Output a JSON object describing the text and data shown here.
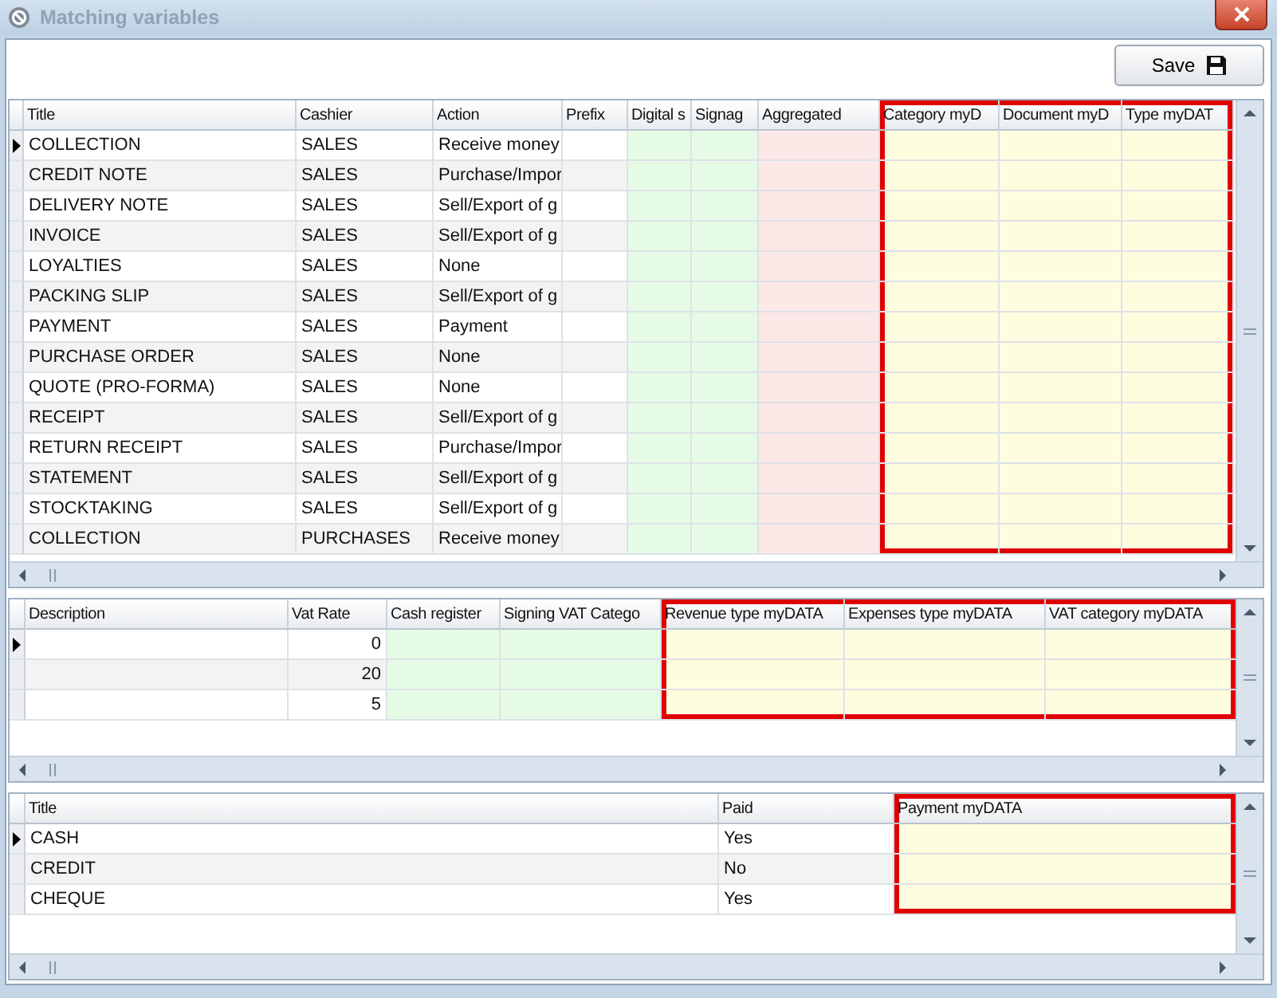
{
  "window": {
    "title": "Matching variables"
  },
  "save_button": {
    "label": "Save"
  },
  "grids": [
    {
      "columns": [
        {
          "label": "Title",
          "highlighted": false
        },
        {
          "label": "Cashier",
          "highlighted": false
        },
        {
          "label": "Action",
          "highlighted": false
        },
        {
          "label": "Prefix",
          "highlighted": false
        },
        {
          "label": "Digital s",
          "color": "#e6fbe6",
          "highlighted": false
        },
        {
          "label": "Signag",
          "color": "#e6fbe6",
          "highlighted": false
        },
        {
          "label": "Aggregated",
          "color": "#fde8e8",
          "highlighted": false
        },
        {
          "label": "Category myD",
          "color": "#fffde0",
          "highlighted": true
        },
        {
          "label": "Document myD",
          "color": "#fffde0",
          "highlighted": true
        },
        {
          "label": "Type myDAT",
          "color": "#fffde0",
          "highlighted": true
        }
      ],
      "rows": [
        {
          "selected": true,
          "cells": [
            "COLLECTION",
            "SALES",
            "Receive money"
          ]
        },
        {
          "selected": false,
          "cells": [
            "CREDIT NOTE",
            "SALES",
            "Purchase/Impor"
          ]
        },
        {
          "selected": false,
          "cells": [
            "DELIVERY NOTE",
            "SALES",
            "Sell/Export of g"
          ]
        },
        {
          "selected": false,
          "cells": [
            "INVOICE",
            "SALES",
            "Sell/Export of g"
          ]
        },
        {
          "selected": false,
          "cells": [
            "LOYALTIES",
            "SALES",
            "None"
          ]
        },
        {
          "selected": false,
          "cells": [
            "PACKING SLIP",
            "SALES",
            "Sell/Export of g"
          ]
        },
        {
          "selected": false,
          "cells": [
            "PAYMENT",
            "SALES",
            "Payment"
          ]
        },
        {
          "selected": false,
          "cells": [
            "PURCHASE ORDER",
            "SALES",
            "None"
          ]
        },
        {
          "selected": false,
          "cells": [
            "QUOTE (PRO-FORMA)",
            "SALES",
            "None"
          ]
        },
        {
          "selected": false,
          "cells": [
            "RECEIPT",
            "SALES",
            "Sell/Export of g"
          ]
        },
        {
          "selected": false,
          "cells": [
            "RETURN RECEIPT",
            "SALES",
            "Purchase/Impor"
          ]
        },
        {
          "selected": false,
          "cells": [
            "STATEMENT",
            "SALES",
            "Sell/Export of g"
          ]
        },
        {
          "selected": false,
          "cells": [
            "STOCKTAKING",
            "SALES",
            "Sell/Export of g"
          ]
        },
        {
          "selected": false,
          "cells": [
            "COLLECTION",
            "PURCHASES",
            "Receive money"
          ]
        }
      ]
    },
    {
      "columns": [
        {
          "label": "Description",
          "highlighted": false
        },
        {
          "label": "Vat Rate",
          "highlighted": false
        },
        {
          "label": "Cash register",
          "color": "#e6fbe6",
          "highlighted": false
        },
        {
          "label": "Signing VAT Catego",
          "color": "#e6fbe6",
          "highlighted": false
        },
        {
          "label": "Revenue type myDATA",
          "color": "#fffde0",
          "highlighted": true
        },
        {
          "label": "Expenses type myDATA",
          "color": "#fffde0",
          "highlighted": true
        },
        {
          "label": "VAT category myDATA",
          "color": "#fffde0",
          "highlighted": true
        }
      ],
      "rows": [
        {
          "selected": true,
          "cells": [
            null,
            "0"
          ]
        },
        {
          "selected": false,
          "cells": [
            null,
            "20"
          ]
        },
        {
          "selected": false,
          "cells": [
            null,
            "5"
          ]
        }
      ]
    },
    {
      "columns": [
        {
          "label": "Title",
          "highlighted": false
        },
        {
          "label": "Paid",
          "highlighted": false
        },
        {
          "label": "Payment myDATA",
          "color": "#fffde0",
          "highlighted": true
        }
      ],
      "rows": [
        {
          "selected": true,
          "cells": [
            "CASH",
            "Yes"
          ]
        },
        {
          "selected": false,
          "cells": [
            "CREDIT",
            "No"
          ]
        },
        {
          "selected": false,
          "cells": [
            "CHEQUE",
            "Yes"
          ]
        }
      ]
    }
  ]
}
